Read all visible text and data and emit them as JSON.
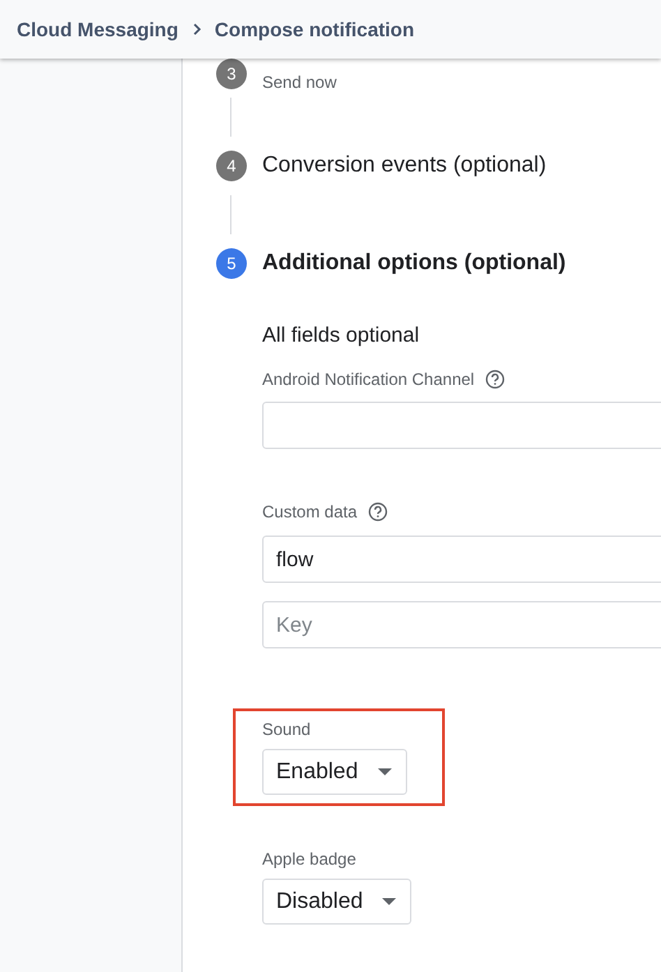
{
  "breadcrumb": [
    {
      "label": "Cloud Messaging"
    },
    {
      "label": "Compose notification"
    }
  ],
  "steps": [
    {
      "number": "3",
      "subtitle": "Send now",
      "selected": false
    },
    {
      "number": "4",
      "title": "Conversion events (optional)",
      "selected": false
    },
    {
      "number": "5",
      "title": "Additional options (optional)",
      "selected": true
    }
  ],
  "options": {
    "heading": "All fields optional",
    "fields": [
      {
        "kind": "text",
        "label": "Android Notification Channel",
        "help": true
      },
      {
        "kind": "key_value",
        "label": "Custom data",
        "help": true,
        "inputs": [
          {
            "value": "flow"
          },
          {
            "placeholder": "Key"
          }
        ]
      },
      {
        "kind": "select",
        "label": "Sound",
        "value": "Enabled",
        "highlighted": true
      },
      {
        "kind": "select",
        "label": "Apple badge",
        "value": "Disabled",
        "highlighted": false
      }
    ]
  }
}
